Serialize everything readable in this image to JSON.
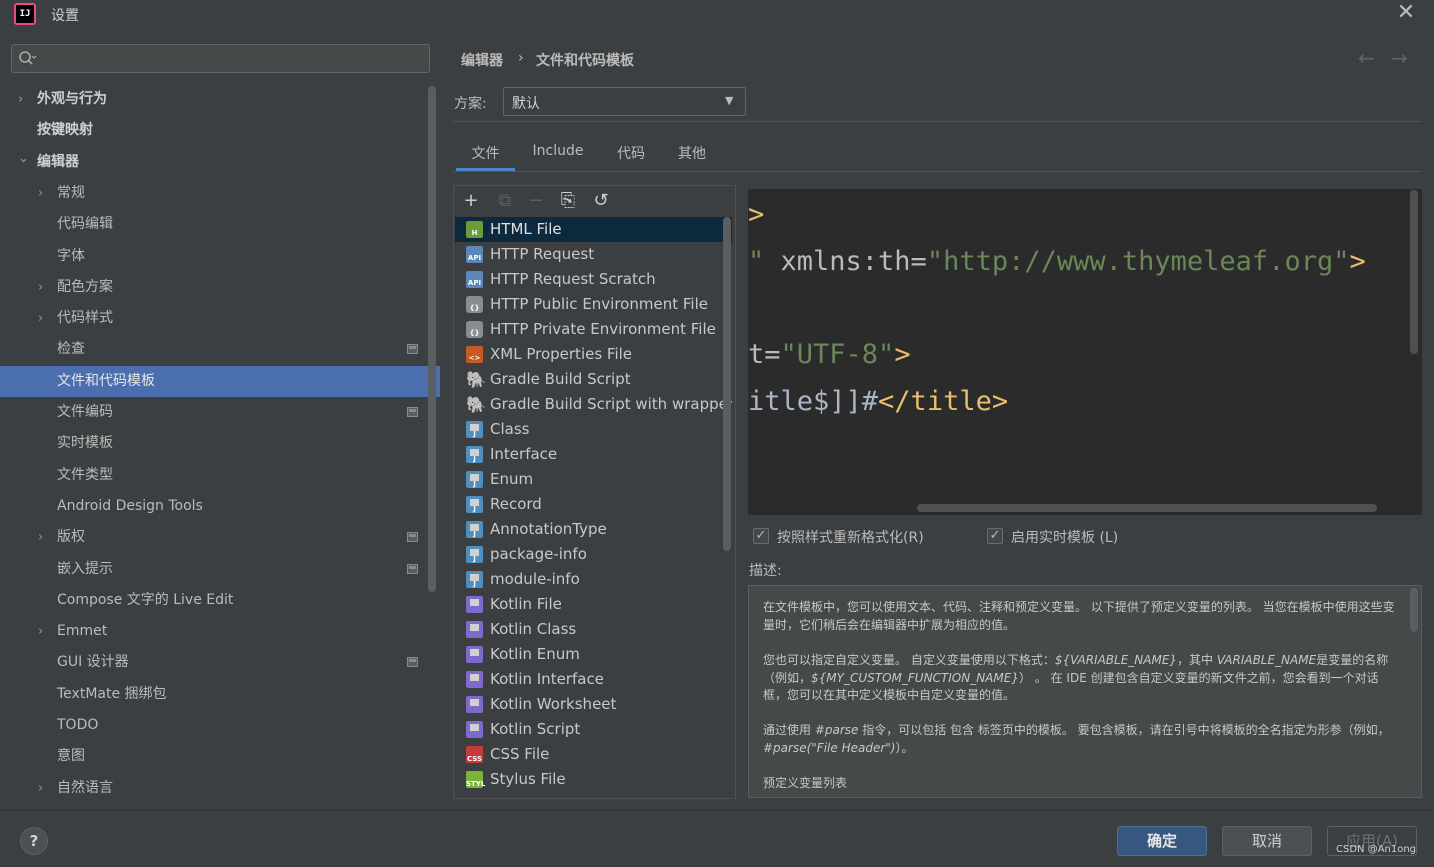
{
  "window": {
    "title": "设置",
    "logo_text": "IJ"
  },
  "sidebar": {
    "search_placeholder": "",
    "items": [
      {
        "label": "外观与行为",
        "level": 0,
        "expandable": true,
        "expanded": false,
        "bold": true
      },
      {
        "label": "按键映射",
        "level": 0,
        "expandable": false,
        "bold": true
      },
      {
        "label": "编辑器",
        "level": 0,
        "expandable": true,
        "expanded": true,
        "bold": true
      },
      {
        "label": "常规",
        "level": 1,
        "expandable": true,
        "expanded": false
      },
      {
        "label": "代码编辑",
        "level": 1
      },
      {
        "label": "字体",
        "level": 1
      },
      {
        "label": "配色方案",
        "level": 1,
        "expandable": true,
        "expanded": false
      },
      {
        "label": "代码样式",
        "level": 1,
        "expandable": true,
        "expanded": false
      },
      {
        "label": "检查",
        "level": 1,
        "project_icon": true
      },
      {
        "label": "文件和代码模板",
        "level": 1,
        "selected": true
      },
      {
        "label": "文件编码",
        "level": 1,
        "project_icon": true
      },
      {
        "label": "实时模板",
        "level": 1
      },
      {
        "label": "文件类型",
        "level": 1
      },
      {
        "label": "Android Design Tools",
        "level": 1
      },
      {
        "label": "版权",
        "level": 1,
        "expandable": true,
        "expanded": false,
        "project_icon": true
      },
      {
        "label": "嵌入提示",
        "level": 1,
        "project_icon": true
      },
      {
        "label": "Compose 文字的 Live Edit",
        "level": 1
      },
      {
        "label": "Emmet",
        "level": 1,
        "expandable": true,
        "expanded": false
      },
      {
        "label": "GUI 设计器",
        "level": 1,
        "project_icon": true
      },
      {
        "label": "TextMate 捆绑包",
        "level": 1
      },
      {
        "label": "TODO",
        "level": 1
      },
      {
        "label": "意图",
        "level": 1
      },
      {
        "label": "自然语言",
        "level": 1,
        "expandable": true,
        "expanded": false
      }
    ]
  },
  "breadcrumb": {
    "parent": "编辑器",
    "separator": "›",
    "current": "文件和代码模板"
  },
  "nav_arrows": {
    "back": "←",
    "forward": "→"
  },
  "scheme": {
    "label": "方案:",
    "value": "默认"
  },
  "tabs": [
    {
      "label": "文件",
      "active": true
    },
    {
      "label": "Include"
    },
    {
      "label": "代码"
    },
    {
      "label": "其他"
    }
  ],
  "toolbar": {
    "add": "+",
    "copy": "⧉",
    "remove": "−",
    "duplicate": "⎘",
    "reset": "↺"
  },
  "templates": [
    {
      "label": "HTML File",
      "icon": "html",
      "icon_text": "H",
      "selected": true
    },
    {
      "label": "HTTP Request",
      "icon": "api",
      "icon_text": "API"
    },
    {
      "label": "HTTP Request Scratch",
      "icon": "api",
      "icon_text": "API"
    },
    {
      "label": "HTTP Public Environment File",
      "icon": "env",
      "icon_text": "{}"
    },
    {
      "label": "HTTP Private Environment File",
      "icon": "env",
      "icon_text": "{}"
    },
    {
      "label": "XML Properties File",
      "icon": "xml",
      "icon_text": "<>"
    },
    {
      "label": "Gradle Build Script",
      "icon": "gradle",
      "icon_text": "🐘"
    },
    {
      "label": "Gradle Build Script with wrapper",
      "icon": "gradle",
      "icon_text": "🐘"
    },
    {
      "label": "Class",
      "icon": "java",
      "icon_text": "J"
    },
    {
      "label": "Interface",
      "icon": "java",
      "icon_text": "J"
    },
    {
      "label": "Enum",
      "icon": "java",
      "icon_text": "J"
    },
    {
      "label": "Record",
      "icon": "java",
      "icon_text": "J"
    },
    {
      "label": "AnnotationType",
      "icon": "java",
      "icon_text": "J"
    },
    {
      "label": "package-info",
      "icon": "java",
      "icon_text": "J"
    },
    {
      "label": "module-info",
      "icon": "java",
      "icon_text": "J"
    },
    {
      "label": "Kotlin File",
      "icon": "kotlin",
      "icon_text": ""
    },
    {
      "label": "Kotlin Class",
      "icon": "kotlin",
      "icon_text": ""
    },
    {
      "label": "Kotlin Enum",
      "icon": "kotlin",
      "icon_text": ""
    },
    {
      "label": "Kotlin Interface",
      "icon": "kotlin",
      "icon_text": ""
    },
    {
      "label": "Kotlin Worksheet",
      "icon": "kotlin",
      "icon_text": ""
    },
    {
      "label": "Kotlin Script",
      "icon": "kotlin",
      "icon_text": ""
    },
    {
      "label": "CSS File",
      "icon": "css",
      "icon_text": "CSS"
    },
    {
      "label": "Stylus File",
      "icon": "styl",
      "icon_text": "STYL"
    }
  ],
  "editor": {
    "lines": [
      [
        {
          "t": ">",
          "c": "t"
        }
      ],
      [
        {
          "t": "\" ",
          "c": "s"
        },
        {
          "t": "xmlns:th=",
          "c": "a"
        },
        {
          "t": "\"http://www.thymeleaf.org\"",
          "c": "s"
        },
        {
          "t": ">",
          "c": "t"
        }
      ],
      [],
      [
        {
          "t": "t=",
          "c": "a"
        },
        {
          "t": "\"UTF-8\"",
          "c": "s"
        },
        {
          "t": ">",
          "c": "t"
        }
      ],
      [
        {
          "t": "itle$]]#",
          "c": "d"
        },
        {
          "t": "</title>",
          "c": "t"
        }
      ]
    ]
  },
  "options": {
    "reformat": {
      "label": "按照样式重新格式化(R)",
      "checked": true
    },
    "live_templates": {
      "label": "启用实时模板 (L)",
      "checked": true
    }
  },
  "description": {
    "label": "描述:",
    "p1": "在文件模板中，您可以使用文本、代码、注释和预定义变量。 以下提供了预定义变量的列表。 当您在模板中使用这些变量时，它们稍后会在编辑器中扩展为相应的值。",
    "p2_a": "您也可以指定自定义变量。 自定义变量使用以下格式：",
    "p2_v1": "${VARIABLE_NAME}",
    "p2_b": "，其中 ",
    "p2_v2": "VARIABLE_NAME",
    "p2_c": "是变量的名称（例如，",
    "p2_v3": "${MY_CUSTOM_FUNCTION_NAME}",
    "p2_d": "） 。 在 IDE 创建包含自定义变量的新文件之前，您会看到一个对话框，您可以在其中定义模板中自定义变量的值。",
    "p3_a": "通过使用 ",
    "p3_v1": "#parse",
    "p3_b": " 指令，可以包括 包含 标签页中的模板。 要包含模板，请在引号中将模板的全名指定为形参（例如，",
    "p3_v2": "#parse(\"File Header\")",
    "p3_c": "）。",
    "p4": "预定义变量列表"
  },
  "footer": {
    "help": "?",
    "ok": "确定",
    "cancel": "取消",
    "apply": "应用(A)"
  },
  "watermark": "CSDN @An1ong"
}
